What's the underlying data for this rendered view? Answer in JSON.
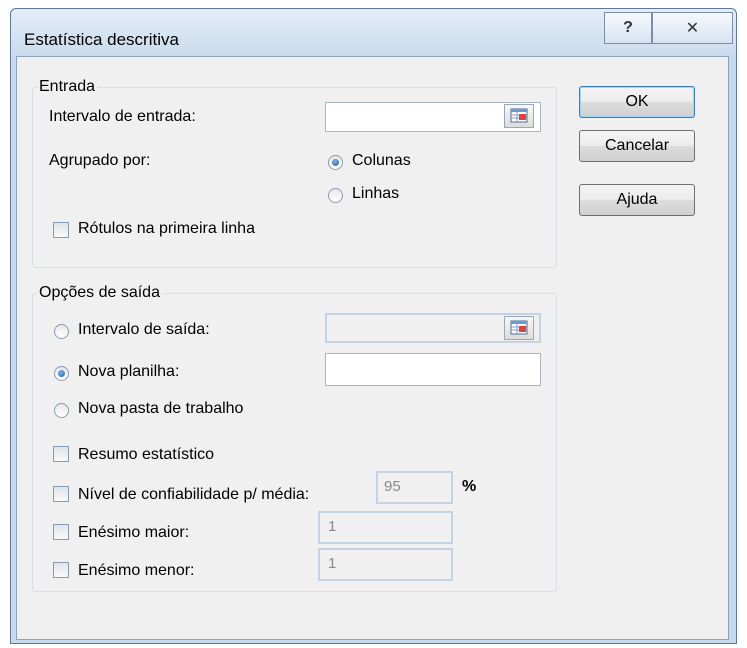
{
  "dialog": {
    "title": "Estatística descritiva",
    "help_glyph": "?",
    "close_glyph": "✕"
  },
  "entrada": {
    "legend": "Entrada",
    "input_range_label": "Intervalo de entrada:",
    "input_range_value": "",
    "grouped_by_label": "Agrupado por:",
    "columns_label": "Colunas",
    "rows_label": "Linhas",
    "grouped_by_selected": "Colunas",
    "labels_first_row_label": "Rótulos na primeira linha",
    "labels_first_row_checked": false
  },
  "saida": {
    "legend": "Opções de saída",
    "output_range_label": "Intervalo de saída:",
    "output_range_value": "",
    "new_sheet_label": "Nova planilha:",
    "new_sheet_value": "",
    "new_workbook_label": "Nova pasta de trabalho",
    "selected_destination": "Nova planilha",
    "summary_stats_label": "Resumo estatístico",
    "summary_stats_checked": false,
    "confidence_label": "Nível de confiabilidade p/ média:",
    "confidence_checked": false,
    "confidence_value": "95",
    "percent_sign": "%",
    "kth_largest_label": "Enésimo maior:",
    "kth_largest_checked": false,
    "kth_largest_value": "1",
    "kth_smallest_label": "Enésimo menor:",
    "kth_smallest_checked": false,
    "kth_smallest_value": "1"
  },
  "buttons": {
    "ok": "OK",
    "cancel": "Cancelar",
    "help": "Ajuda"
  },
  "colors": {
    "dialog_background": "#f0f0f0",
    "frame": "#c7d9ec",
    "radio_dot": "#1c5aa6"
  }
}
